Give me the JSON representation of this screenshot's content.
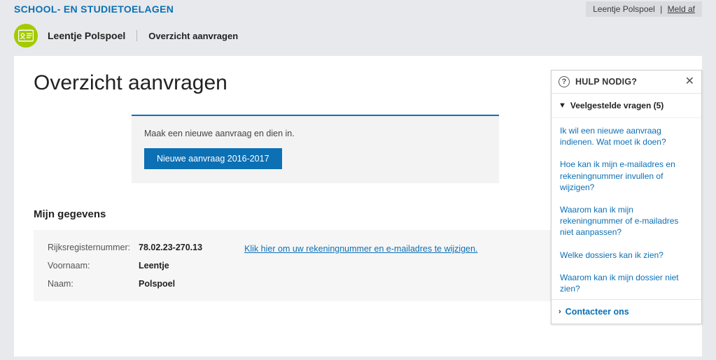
{
  "top": {
    "site_title": "SCHOOL- EN STUDIETOELAGEN",
    "user_name": "Leentje Polspoel",
    "logout_label": "Meld af"
  },
  "header": {
    "user_name": "Leentje Polspoel",
    "breadcrumb": "Overzicht aanvragen"
  },
  "main": {
    "page_title": "Overzicht aanvragen",
    "new_request": {
      "prompt": "Maak een nieuwe aanvraag en dien in.",
      "button_label": "Nieuwe aanvraag 2016-2017"
    },
    "details": {
      "section_title": "Mijn gegevens",
      "rows": [
        {
          "label": "Rijksregisternummer:",
          "value": "78.02.23-270.13"
        },
        {
          "label": "Voornaam:",
          "value": "Leentje"
        },
        {
          "label": "Naam:",
          "value": "Polspoel"
        }
      ],
      "change_link": "Klik hier om uw rekeningnummer en e-mailadres te wijzigen."
    }
  },
  "help": {
    "title": "HULP NODIG?",
    "faq_header": "Veelgestelde vragen (5)",
    "faq_items": [
      "Ik wil een nieuwe aanvraag indienen. Wat moet ik doen?",
      "Hoe kan ik mijn e-mailadres en rekeningnummer invullen of wijzigen?",
      "Waarom kan ik mijn rekeningnummer of e-mailadres niet aanpassen?",
      "Welke dossiers kan ik zien?",
      "Waarom kan ik mijn dossier niet zien?"
    ],
    "contact_label": "Contacteer ons"
  }
}
